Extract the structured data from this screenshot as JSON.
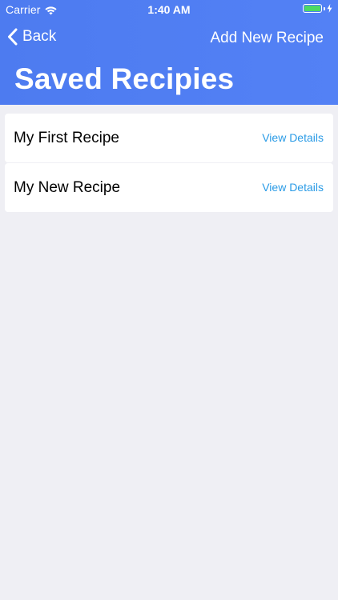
{
  "status_bar": {
    "carrier": "Carrier",
    "time": "1:40 AM",
    "battery_color": "#4cd964"
  },
  "nav": {
    "back_label": "Back",
    "add_label": "Add New Recipe",
    "title": "Saved Recipies",
    "background_color": "#4d7bf0"
  },
  "recipes": [
    {
      "title": "My First Recipe",
      "link_label": "View Details"
    },
    {
      "title": "My New Recipe",
      "link_label": "View Details"
    }
  ],
  "colors": {
    "page_background": "#efeff4",
    "link": "#2a9be6"
  },
  "icons": {
    "wifi": "wifi-icon",
    "battery": "battery-icon",
    "charging": "charging-bolt-icon",
    "back": "chevron-left-icon"
  }
}
